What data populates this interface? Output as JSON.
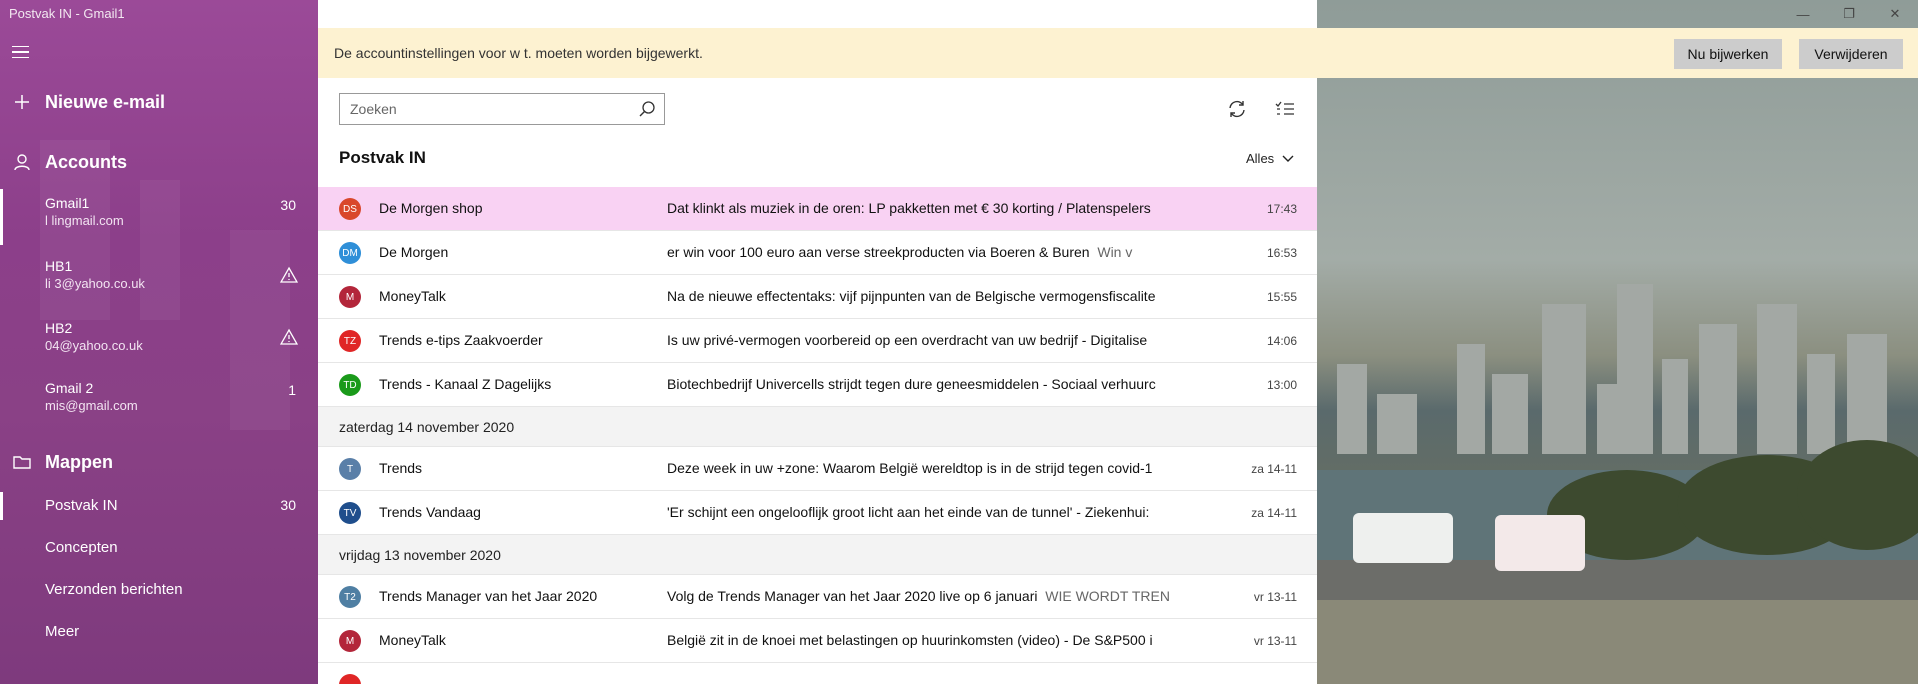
{
  "window": {
    "title": "Postvak IN - Gmail1",
    "minimize": "—",
    "maximize": "❐",
    "close": "✕"
  },
  "sidebar": {
    "new_mail": "Nieuwe e-mail",
    "accounts_header": "Accounts",
    "accounts": [
      {
        "name": "Gmail1",
        "email": "l     lingmail.com",
        "count": "30",
        "warning": false
      },
      {
        "name": "HB1",
        "email": "li       3@yahoo.co.uk",
        "count": "",
        "warning": true
      },
      {
        "name": "HB2",
        "email": "     04@yahoo.co.uk",
        "count": "",
        "warning": true
      },
      {
        "name": "Gmail 2",
        "email": "     mis@gmail.com",
        "count": "1",
        "warning": false
      }
    ],
    "folders_header": "Mappen",
    "folders": [
      {
        "label": "Postvak IN",
        "count": "30"
      },
      {
        "label": "Concepten",
        "count": ""
      },
      {
        "label": "Verzonden berichten",
        "count": ""
      },
      {
        "label": "Meer",
        "count": ""
      }
    ]
  },
  "infobar": {
    "text": "De accountinstellingen voor            w            t.  moeten worden bijgewerkt.",
    "update_button": "Nu bijwerken",
    "remove_button": "Verwijderen"
  },
  "search": {
    "placeholder": "Zoeken"
  },
  "list": {
    "title": "Postvak IN",
    "filter": "Alles",
    "groups": [
      {
        "heading": "",
        "items": [
          {
            "initials": "DS",
            "color": "#d9472b",
            "sender": "De Morgen shop",
            "subject": "Dat klinkt als muziek in de oren: LP pakketten met € 30 korting / Platenspelers",
            "preview": "",
            "time": "17:43",
            "selected": true
          },
          {
            "initials": "DM",
            "color": "#2f8fd8",
            "sender": "De Morgen",
            "subject": "  er     win voor 100 euro aan verse streekproducten via Boeren & Buren",
            "preview": "Win v",
            "time": "16:53",
            "selected": false
          },
          {
            "initials": "M",
            "color": "#b3263a",
            "sender": "MoneyTalk",
            "subject": "Na de nieuwe effectentaks: vijf pijnpunten van de Belgische vermogensfiscalite",
            "preview": "",
            "time": "15:55",
            "selected": false
          },
          {
            "initials": "TZ",
            "color": "#e02626",
            "sender": "Trends e-tips Zaakvoerder",
            "subject": "Is uw privé-vermogen voorbereid op een overdracht van uw bedrijf - Digitalise",
            "preview": "",
            "time": "14:06",
            "selected": false
          },
          {
            "initials": "TD",
            "color": "#1a9a1a",
            "sender": "Trends - Kanaal Z Dagelijks",
            "subject": "Biotechbedrijf Univercells strijdt tegen dure geneesmiddelen - Sociaal verhuurc",
            "preview": "",
            "time": "13:00",
            "selected": false
          }
        ]
      },
      {
        "heading": "zaterdag 14 november 2020",
        "items": [
          {
            "initials": "T",
            "color": "#5a7fa8",
            "sender": "Trends",
            "subject": "Deze week in uw +zone: Waarom België wereldtop is in de strijd tegen covid-1",
            "preview": "",
            "time": "za 14-11",
            "selected": false
          },
          {
            "initials": "TV",
            "color": "#1f4e8c",
            "sender": "Trends Vandaag",
            "subject": "'Er schijnt een ongelooflijk groot licht aan het einde van de tunnel' - Ziekenhui:",
            "preview": "",
            "time": "za 14-11",
            "selected": false
          }
        ]
      },
      {
        "heading": "vrijdag 13 november 2020",
        "items": [
          {
            "initials": "T2",
            "color": "#4f7fa3",
            "sender": "Trends Manager van het Jaar 2020",
            "subject": "Volg de Trends Manager van het Jaar 2020 live op 6 januari",
            "preview": "WIE WORDT TREN",
            "time": "vr 13-11",
            "selected": false
          },
          {
            "initials": "M",
            "color": "#b3263a",
            "sender": "MoneyTalk",
            "subject": "België zit in de knoei met belastingen op huurinkomsten (video) - De S&P500 i",
            "preview": "",
            "time": "vr 13-11",
            "selected": false
          }
        ]
      }
    ]
  }
}
